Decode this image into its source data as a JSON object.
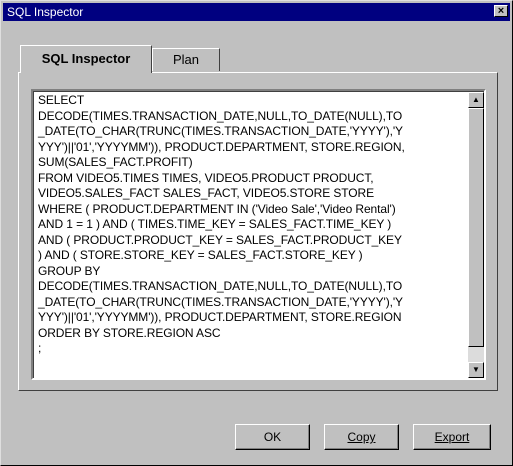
{
  "window": {
    "title": "SQL Inspector",
    "close_glyph": "×"
  },
  "tabs": [
    {
      "label": "SQL Inspector",
      "active": true
    },
    {
      "label": "Plan",
      "active": false
    }
  ],
  "sql": {
    "lines": [
      "SELECT",
      "DECODE(TIMES.TRANSACTION_DATE,NULL,TO_DATE(NULL),TO",
      "_DATE(TO_CHAR(TRUNC(TIMES.TRANSACTION_DATE,'YYYY'),'Y",
      "YYY')||'01','YYYYMM')), PRODUCT.DEPARTMENT, STORE.REGION,",
      "SUM(SALES_FACT.PROFIT)",
      "FROM VIDEO5.TIMES TIMES, VIDEO5.PRODUCT PRODUCT,",
      "VIDEO5.SALES_FACT SALES_FACT, VIDEO5.STORE STORE",
      "WHERE ( PRODUCT.DEPARTMENT IN ('Video Sale','Video Rental')",
      "AND 1 = 1 ) AND ( TIMES.TIME_KEY = SALES_FACT.TIME_KEY )",
      "AND ( PRODUCT.PRODUCT_KEY = SALES_FACT.PRODUCT_KEY",
      ") AND ( STORE.STORE_KEY = SALES_FACT.STORE_KEY )",
      "GROUP BY",
      "DECODE(TIMES.TRANSACTION_DATE,NULL,TO_DATE(NULL),TO",
      "_DATE(TO_CHAR(TRUNC(TIMES.TRANSACTION_DATE,'YYYY'),'Y",
      "YYY')||'01','YYYYMM')), PRODUCT.DEPARTMENT, STORE.REGION",
      "ORDER BY STORE.REGION ASC",
      ";"
    ]
  },
  "scrollbar": {
    "up_icon": "▲",
    "down_icon": "▼"
  },
  "buttons": {
    "ok": "OK",
    "copy": "Copy",
    "export": "Export"
  }
}
